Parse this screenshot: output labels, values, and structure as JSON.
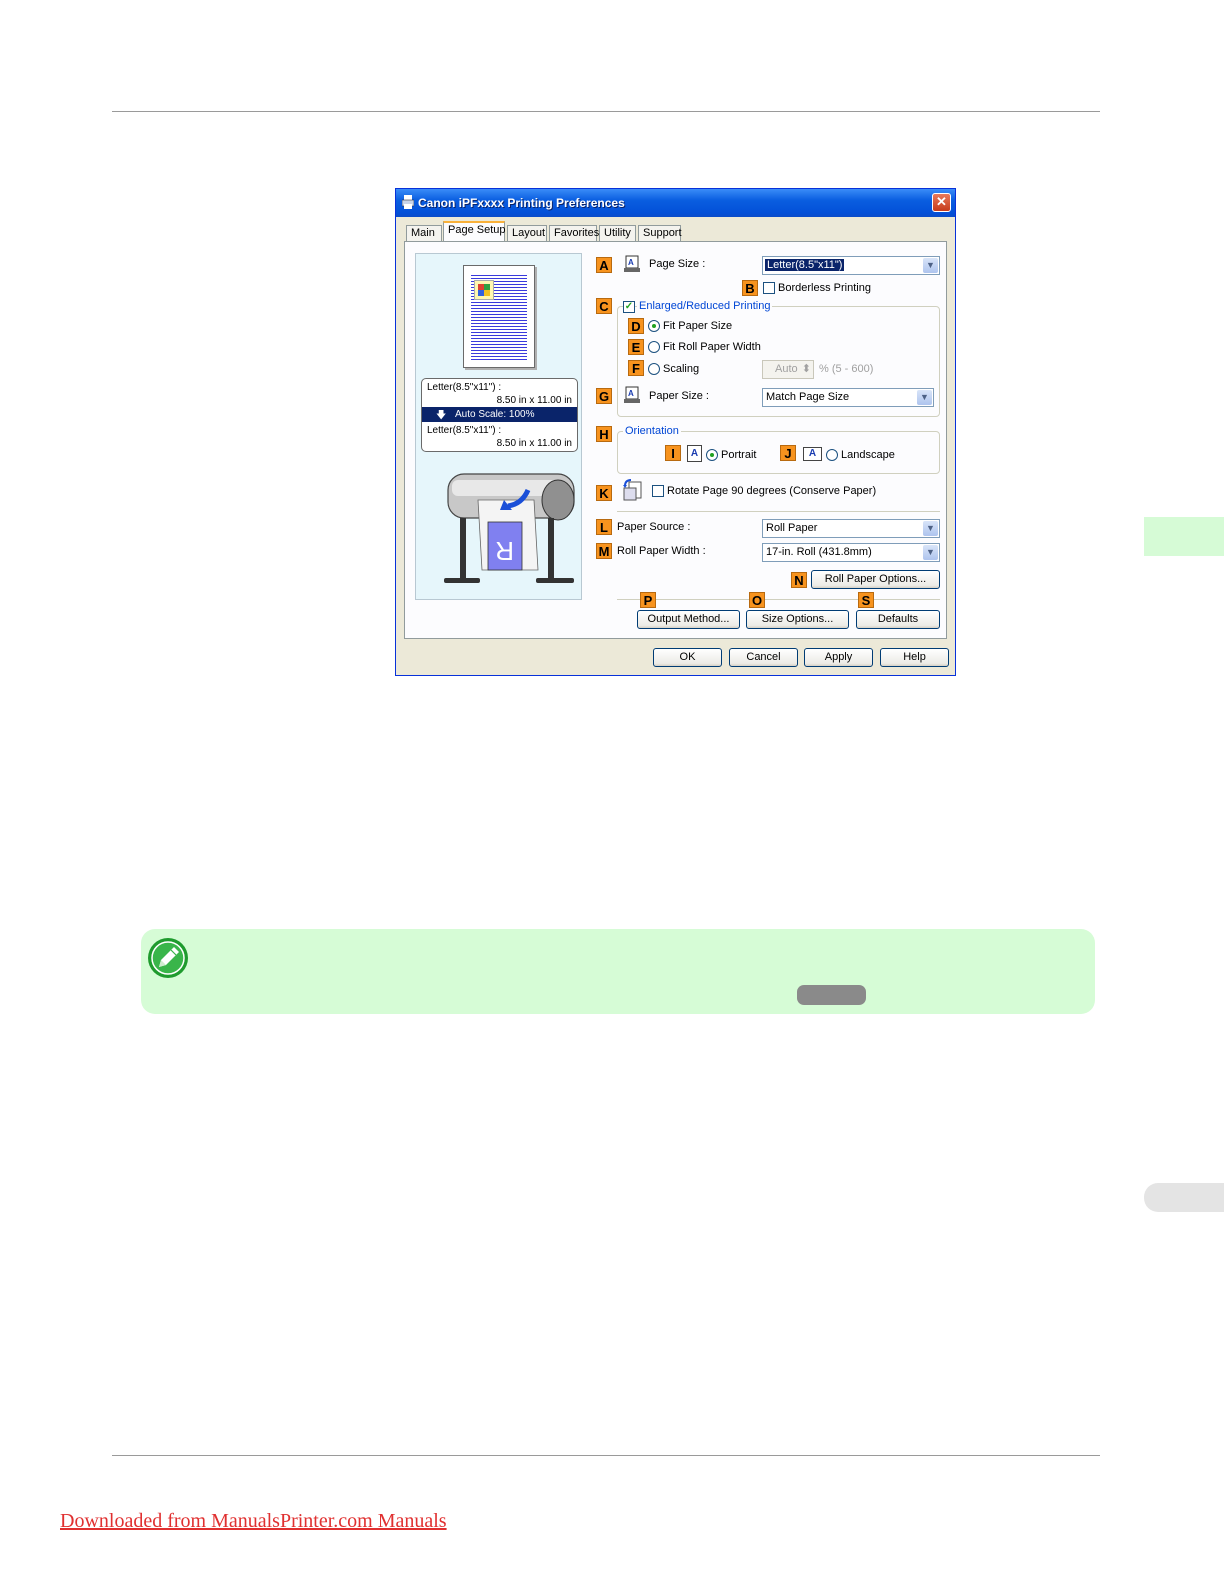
{
  "dialog": {
    "title": "Canon iPFxxxx Printing Preferences",
    "close_glyph": "✕",
    "tabs": [
      {
        "label": "Main"
      },
      {
        "label": "Page Setup"
      },
      {
        "label": "Layout"
      },
      {
        "label": "Favorites"
      },
      {
        "label": "Utility"
      },
      {
        "label": "Support"
      }
    ],
    "active_tab": "Page Setup",
    "preview": {
      "line1": "Letter(8.5\"x11\") :",
      "line2": "8.50 in x 11.00 in",
      "band": "Auto Scale: 100%",
      "band_arrow": "🡇",
      "line3": "Letter(8.5\"x11\") :",
      "line4": "8.50 in x 11.00 in"
    },
    "markers": {
      "A": "A",
      "B": "B",
      "C": "C",
      "D": "D",
      "E": "E",
      "F": "F",
      "G": "G",
      "H": "H",
      "I": "I",
      "J": "J",
      "K": "K",
      "L": "L",
      "M": "M",
      "N": "N",
      "P": "P",
      "O": "O",
      "S": "S"
    },
    "page_size": {
      "label": "Page Size :",
      "value": "Letter(8.5\"x11\")"
    },
    "borderless": {
      "label": "Borderless Printing",
      "checked": false
    },
    "enlarged": {
      "label": "Enlarged/Reduced Printing",
      "checked": true,
      "check_glyph": "✓"
    },
    "fit_paper_size": {
      "label": "Fit Paper Size",
      "selected": true
    },
    "fit_roll_width": {
      "label": "Fit Roll Paper Width",
      "selected": false
    },
    "scaling": {
      "label": "Scaling",
      "selected": false,
      "value": "Auto",
      "range": "% (5 - 600)"
    },
    "paper_size": {
      "label": "Paper Size :",
      "value": "Match Page Size"
    },
    "orientation": {
      "title": "Orientation",
      "portrait": {
        "label": "Portrait",
        "selected": true,
        "icon_glyph": "A"
      },
      "landscape": {
        "label": "Landscape",
        "selected": false,
        "icon_glyph": "A"
      }
    },
    "rotate": {
      "label": "Rotate Page 90 degrees (Conserve Paper)",
      "checked": false
    },
    "paper_source": {
      "label": "Paper Source :",
      "value": "Roll Paper"
    },
    "roll_width": {
      "label": "Roll Paper Width :",
      "value": "17-in. Roll (431.8mm)"
    },
    "buttons": {
      "roll_paper_options": "Roll Paper Options...",
      "output_method": "Output Method...",
      "size_options": "Size Options...",
      "defaults": "Defaults",
      "ok": "OK",
      "cancel": "Cancel",
      "apply": "Apply",
      "help": "Help"
    },
    "dropdown_glyph": "▼",
    "spin_glyph": "⬍"
  },
  "footer": {
    "link_text": "Downloaded from ManualsPrinter.com Manuals"
  },
  "colors": {
    "marker": "#f7931e",
    "note_bg": "#d6fcd6",
    "title_bar": "#0a5ee0",
    "footer_link": "#e03030"
  }
}
